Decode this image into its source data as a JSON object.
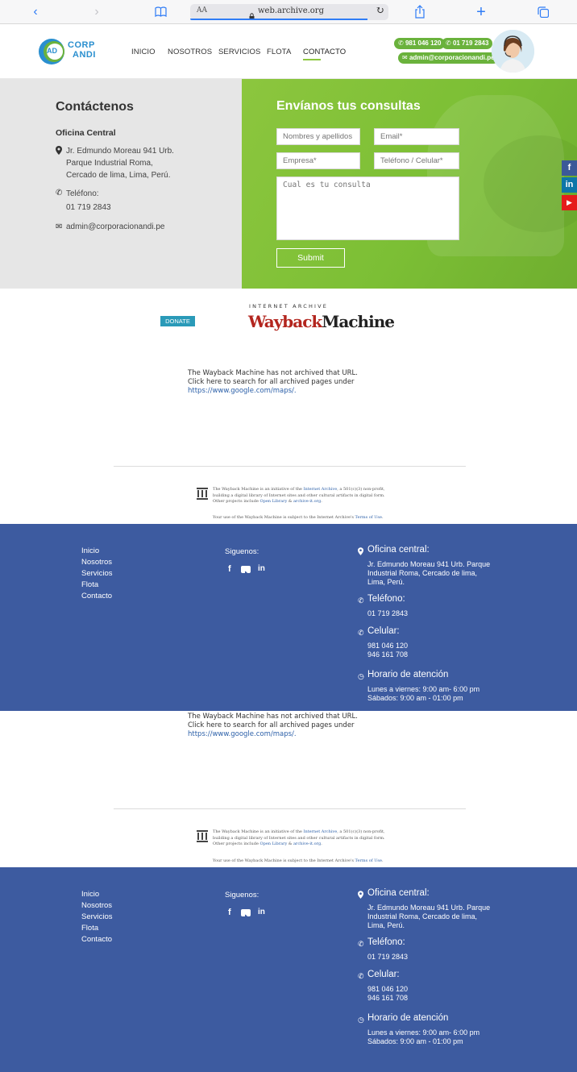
{
  "browser": {
    "aa_label": "AA",
    "url": "web.archive.org",
    "icons": [
      "chevron-left-icon",
      "chevron-right-icon",
      "book-icon",
      "lock-icon",
      "reload-icon",
      "share-icon",
      "plus-icon",
      "tabs-icon"
    ]
  },
  "header": {
    "logo_text_1": "CORP",
    "logo_text_2": "ANDI",
    "logo_mark": "AD",
    "nav": [
      "INICIO",
      "NOSOTROS",
      "SERVICIOS",
      "FLOTA",
      "CONTACTO"
    ],
    "phone_cell": "981 046 120",
    "phone_land": "01 719 2843",
    "email": "admin@corporacionandi.pe",
    "brand_green": "#6ab23c"
  },
  "contact": {
    "title": "Contáctenos",
    "office_label": "Oficina Central",
    "address_lines": [
      "Jr. Edmundo Moreau 941 Urb.",
      "Parque Industrial Roma,",
      "Cercado de lima, Lima, Perú."
    ],
    "phone_label": "Teléfono:",
    "phone": "01 719 2843",
    "email": "admin@corporacionandi.pe"
  },
  "form": {
    "title": "Envíanos tus consultas",
    "name_ph": "Nombres y apellidos",
    "email_ph": "Email*",
    "company_ph": "Empresa*",
    "phone_ph": "Teléfono / Celular*",
    "message_ph": "Cual es tu consulta",
    "submit": "Submit"
  },
  "wayback": {
    "donate": "DONATE",
    "ia_label": "INTERNET ARCHIVE",
    "logo_w": "Wayback",
    "logo_m": "Machine",
    "msg_1": "The Wayback Machine has not archived that URL.",
    "msg_2": "Click here to search for all archived pages under",
    "msg_link": "https://www.google.com/maps/.",
    "foot_1a": "The Wayback Machine is an initiative of the ",
    "foot_1b": "Internet Archive",
    "foot_1c": ", a 501(c)(3) non-profit,",
    "foot_2": "building a digital library of Internet sites and other cultural artifacts in digital form.",
    "foot_3a": "Other projects include ",
    "foot_3b": "Open Library",
    "foot_3c": " & ",
    "foot_3d": "archive-it.org",
    "foot_3e": ".",
    "foot_4a": "Your use of the Wayback Machine is subject to the Internet Archive's ",
    "foot_4b": "Terms of Use",
    "foot_4c": "."
  },
  "footer": {
    "links": [
      "Inicio",
      "Nosotros",
      "Servicios",
      "Flota",
      "Contacto"
    ],
    "follow": "Siguenos:",
    "social_icons": [
      "facebook-icon",
      "youtube-icon",
      "linkedin-icon"
    ],
    "office_h": "Oficina central:",
    "office_lines": [
      "Jr. Edmundo Moreau 941 Urb. Parque",
      "Industrial Roma, Cercado de lima,",
      "Lima, Perú."
    ],
    "phone_h": "Teléfono:",
    "phone": "01 719 2843",
    "cell_h": "Celular:",
    "cells": [
      "981 046 120",
      "946 161 708"
    ],
    "hours_h": "Horario de atención",
    "hours": [
      "Lunes a viernes: 9:00 am- 6:00 pm",
      "Sábados: 9:00 am - 01:00 pm"
    ],
    "bg": "#3d5ba0"
  },
  "side_social": [
    "f",
    "in",
    "▶"
  ]
}
